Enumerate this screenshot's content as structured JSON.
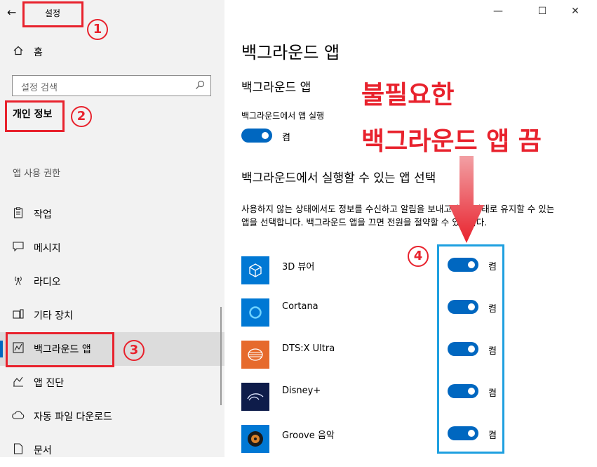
{
  "window": {
    "title": "설정",
    "back_icon": "←",
    "minimize_icon": "—",
    "maximize_icon": "☐",
    "close_icon": "✕"
  },
  "sidebar": {
    "home_label": "홈",
    "search_placeholder": "설정 검색",
    "section_title": "개인 정보",
    "group_label": "앱 사용 권한",
    "items": [
      {
        "label": "작업",
        "icon": "task-icon"
      },
      {
        "label": "메시지",
        "icon": "message-icon"
      },
      {
        "label": "라디오",
        "icon": "radio-icon"
      },
      {
        "label": "기타 장치",
        "icon": "device-icon"
      },
      {
        "label": "백그라운드 앱",
        "icon": "background-apps-icon",
        "selected": true
      },
      {
        "label": "앱 진단",
        "icon": "diagnostics-icon"
      },
      {
        "label": "자동 파일 다운로드",
        "icon": "cloud-icon"
      },
      {
        "label": "문서",
        "icon": "document-icon"
      }
    ]
  },
  "main": {
    "page_title": "백그라운드 앱",
    "sub_title": "백그라운드 앱",
    "run_label": "백그라운드에서 앱 실행",
    "run_toggle_text": "켬",
    "select_title": "백그라운드에서 실행할 수 있는 앱 선택",
    "description": "사용하지 않는 상태에서도 정보를 수신하고 알림을 보내고 최신 상태로 유지할 수 있는 앱을 선택합니다. 백그라운드 앱을 끄면 전원을 절약할 수 있습니다.",
    "apps": [
      {
        "name": "3D 뷰어",
        "toggle_text": "켬",
        "tile_color": "#0078d4",
        "icon": "cube-icon"
      },
      {
        "name": "Cortana",
        "toggle_text": "켬",
        "tile_color": "#0078d4",
        "icon": "cortana-icon"
      },
      {
        "name": "DTS:X Ultra",
        "toggle_text": "켬",
        "tile_color": "#e66a2c",
        "icon": "dts-icon"
      },
      {
        "name": "Disney+",
        "toggle_text": "켬",
        "tile_color": "#0e1c4a",
        "icon": "disney-icon"
      },
      {
        "name": "Groove 음악",
        "toggle_text": "켬",
        "tile_color": "#0078d4",
        "icon": "groove-icon"
      }
    ]
  },
  "annotations": {
    "n1": "1",
    "n2": "2",
    "n3": "3",
    "n4": "4",
    "text1": "불필요한",
    "text2": "백그라운드 앱 끔"
  },
  "colors": {
    "accent": "#0067c0",
    "annotation_red": "#e8222d",
    "annotation_blue": "#1ea0e0"
  }
}
